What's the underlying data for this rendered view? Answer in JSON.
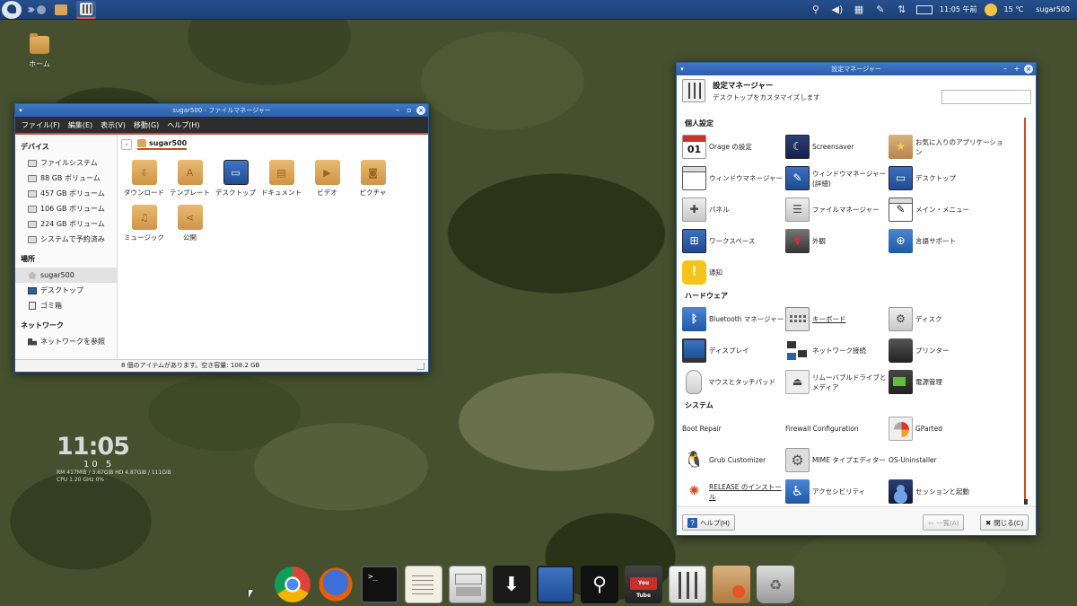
{
  "top_panel": {
    "time": "11:05 午前",
    "temperature": "15 ℃",
    "user": "sugar500",
    "icons": [
      "search-icon",
      "volume-icon",
      "keyboard-icon",
      "pen-icon",
      "network-icon",
      "mail-icon",
      "weather-icon"
    ]
  },
  "desktop": {
    "home_label": "ホーム"
  },
  "conky": {
    "clock": "11:05",
    "date": "10 5",
    "line1": "RM 417MiB / 3.67GiB  HD 4.87GiB / 111GiB",
    "line2": "CPU 1.20 GHz 0% ·"
  },
  "file_manager": {
    "title": "sugar500 - ファイルマネージャー",
    "menu": [
      "ファイル(F)",
      "編集(E)",
      "表示(V)",
      "移動(G)",
      "ヘルプ(H)"
    ],
    "sidebar": {
      "devices_header": "デバイス",
      "devices": [
        "ファイルシステム",
        "88 GB ボリューム",
        "457 GB ボリューム",
        "106 GB ボリューム",
        "224 GB ボリューム",
        "システムで予約済み"
      ],
      "places_header": "場所",
      "places": [
        "sugar500",
        "デスクトップ",
        "ゴミ箱"
      ],
      "network_header": "ネットワーク",
      "network": [
        "ネットワークを参照"
      ]
    },
    "path": "sugar500",
    "items": [
      "ダウンロード",
      "テンプレート",
      "デスクトップ",
      "ドキュメント",
      "ビデオ",
      "ピクチャ",
      "ミュージック",
      "公開"
    ],
    "status": "8 個のアイテムがあります。空き容量: 108.2 GB"
  },
  "settings_manager": {
    "title": "設定マネージャー",
    "header_title": "設定マネージャー",
    "header_subtitle": "デスクトップをカスタマイズします",
    "search_placeholder": "",
    "sections": {
      "personal": "個人設定",
      "hardware": "ハードウェア",
      "system": "システム"
    },
    "personal": {
      "orage": "Orage の設定",
      "orage_day": "01",
      "screensaver": "Screensaver",
      "favorites": "お気に入りのアプリケーション",
      "wm": "ウィンドウマネージャー",
      "wm_tweaks": "ウィンドウマネージャー (詳細)",
      "desktop": "デスクトップ",
      "panel": "パネル",
      "file_manager": "ファイルマネージャー",
      "main_menu": "メイン・メニュー",
      "workspaces": "ワークスペース",
      "appearance": "外観",
      "language": "言語サポート",
      "notifications": "通知"
    },
    "hardware": {
      "bluetooth": "Bluetooth マネージャー",
      "keyboard": "キーボード",
      "disks": "ディスク",
      "display": "ディスプレイ",
      "network": "ネットワーク接続",
      "printer": "プリンター",
      "mouse": "マウスとタッチパッド",
      "removable": "リムーバブルドライブとメディア",
      "power": "電源管理"
    },
    "system": {
      "boot_repair": "Boot Repair",
      "firewall": "Firewall Configuration",
      "gparted": "GParted",
      "grub": "Grub Customizer",
      "mime": "MIME タイプエディター",
      "os_uninstaller": "OS-Uninstaller",
      "release": "RELEASE のインストール",
      "accessibility": "アクセシビリティ",
      "session": "セッションと起動"
    },
    "footer": {
      "help": "ヘルプ(H)",
      "all": "一覧(A)",
      "close": "閉じる(C)"
    }
  },
  "dock": {
    "items": [
      "chrome-icon",
      "firefox-icon",
      "terminal-icon",
      "text-editor-icon",
      "file-cabinet-icon",
      "download-icon",
      "desktop-icon",
      "search-icon",
      "youtube-icon",
      "settings-icon",
      "package-icon",
      "trash-icon"
    ],
    "terminal_prompt": ">_"
  }
}
